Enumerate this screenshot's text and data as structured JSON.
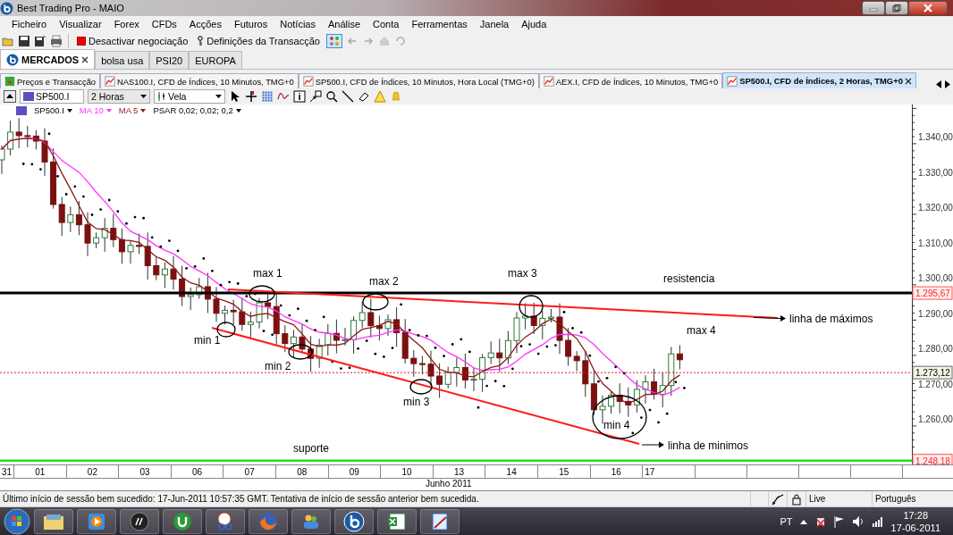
{
  "window": {
    "title": "Best Trading Pro - MAIO"
  },
  "menu": [
    "Ficheiro",
    "Visualizar",
    "Forex",
    "CFDs",
    "Acções",
    "Futuros",
    "Notícias",
    "Análise",
    "Conta",
    "Ferramentas",
    "Janela",
    "Ajuda"
  ],
  "toolbar": {
    "disable_trading": "Desactivar negociação",
    "transaction_settings": "Definições da Transacção",
    "layout_toggle_on": true
  },
  "market_tabs": [
    {
      "label": "MERCADOS",
      "selected": true
    },
    {
      "label": "bolsa usa",
      "selected": false
    },
    {
      "label": "PSI20",
      "selected": false
    },
    {
      "label": "EUROPA",
      "selected": false
    }
  ],
  "chart_tabs": [
    {
      "label": "Preços e Transacção",
      "kind": "prices",
      "selected": false
    },
    {
      "label": "NAS100.I, CFD de Índices, 10 Minutos, TMG+0",
      "kind": "chart",
      "selected": false
    },
    {
      "label": "SP500.I, CFD de Índices, 10 Minutos, Hora Local (TMG+0)",
      "kind": "chart",
      "selected": false
    },
    {
      "label": "AEX.I, CFD de Índices, 10 Minutos, TMG+0",
      "kind": "chart",
      "selected": false
    },
    {
      "label": "SP500.I, CFD de Índices, 2 Horas, TMG+0",
      "kind": "chart",
      "selected": true
    }
  ],
  "chart_toolbar": {
    "symbol": "SP500.I",
    "period": "2 Horas",
    "chart_type": "Vela"
  },
  "legend": [
    {
      "label": "SP500.I",
      "color": "#000000"
    },
    {
      "label": "MA 10",
      "color": "#ff33ff"
    },
    {
      "label": "MA 5",
      "color": "#8b1a1a"
    },
    {
      "label": "PSAR 0,02; 0,02; 0,2",
      "color": "#000000"
    }
  ],
  "price_axis": [
    "1.340,00",
    "1.330,00",
    "1.320,00",
    "1.310,00",
    "1.300,00",
    "1.290,00",
    "1.280,00",
    "1.270,00",
    "1.260,00"
  ],
  "price_tags": [
    {
      "value": "1.295,67",
      "kind": "resistance"
    },
    {
      "value": "1.273,12",
      "kind": "current"
    },
    {
      "value": "1.248,18",
      "kind": "support"
    }
  ],
  "annotations": [
    "max 1",
    "max 2",
    "max 3",
    "max 4",
    "min 1",
    "min 2",
    "min 3",
    "min 4",
    "resistencia",
    "suporte",
    "linha de máximos",
    "linha de minimos"
  ],
  "dates": [
    "31",
    "01",
    "02",
    "03",
    "06",
    "07",
    "08",
    "09",
    "10",
    "13",
    "14",
    "15",
    "16",
    "17"
  ],
  "month": "Junho 2011",
  "status_bar": {
    "message": "Último início de sessão bem sucedido: 17-Jun-2011 10:57:35 GMT. Tentativa de início de sessão anterior bem sucedida.",
    "mode": "Live",
    "language": "Português"
  },
  "taskbar": {
    "language": "PT",
    "time": "17:28",
    "date": "17-06-2011"
  }
}
